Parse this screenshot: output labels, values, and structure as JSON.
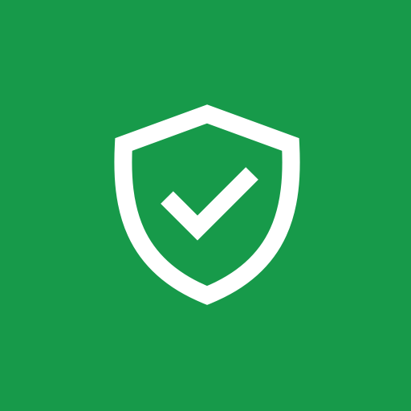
{
  "app_icon": {
    "icon": "shield-check-icon",
    "background_color": "#179a4a",
    "foreground_color": "#ffffff"
  }
}
